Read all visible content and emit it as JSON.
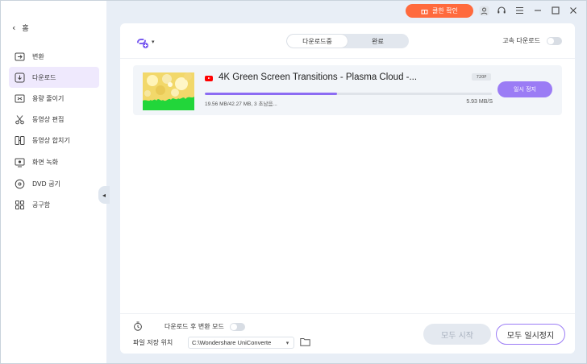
{
  "titlebar": {
    "promo_label": "쿨한 확인",
    "icons": [
      "user-icon",
      "headset-icon",
      "menu-icon",
      "minimize-icon",
      "maximize-icon",
      "close-icon"
    ]
  },
  "sidebar": {
    "back_label": "홈",
    "items": [
      {
        "label": "변환",
        "icon": "convert-icon",
        "active": false
      },
      {
        "label": "다운로드",
        "icon": "download-icon",
        "active": true
      },
      {
        "label": "용량 줄이기",
        "icon": "compress-icon",
        "active": false
      },
      {
        "label": "동영상 편집",
        "icon": "scissors-icon",
        "active": false
      },
      {
        "label": "동영상 합치기",
        "icon": "merge-icon",
        "active": false
      },
      {
        "label": "화면 녹화",
        "icon": "record-icon",
        "active": false
      },
      {
        "label": "DVD 굽기",
        "icon": "disc-icon",
        "active": false
      },
      {
        "label": "공구함",
        "icon": "toolbox-icon",
        "active": false
      }
    ]
  },
  "main": {
    "tabs": [
      {
        "label": "다운로드중",
        "active": true
      },
      {
        "label": "완료",
        "active": false
      }
    ],
    "turbo_label": "고속 다운로드",
    "turbo_on": false
  },
  "download": {
    "title": "4K Green Screen Transitions - Plasma Cloud -...",
    "quality": "720P",
    "status": "19.56 MB/42.27 MB, 3 초남음...",
    "speed": "5.93 MB/S",
    "progress": 0.46,
    "pause_label": "일시 정지",
    "source_icon": "youtube-icon"
  },
  "footer": {
    "convert_mode_label": "다운로드 후 변환 모드",
    "convert_mode_on": false,
    "save_location_label": "파일 저장 위치",
    "save_path": "C:\\Wondershare UniConverte",
    "start_all_label": "모두 시작",
    "pause_all_label": "모두 일시정지"
  },
  "colors": {
    "accent": "#9b7cf5",
    "promo": "#ff6a3d",
    "active_nav_bg": "#efe9fd",
    "background": "#e8eef6"
  }
}
